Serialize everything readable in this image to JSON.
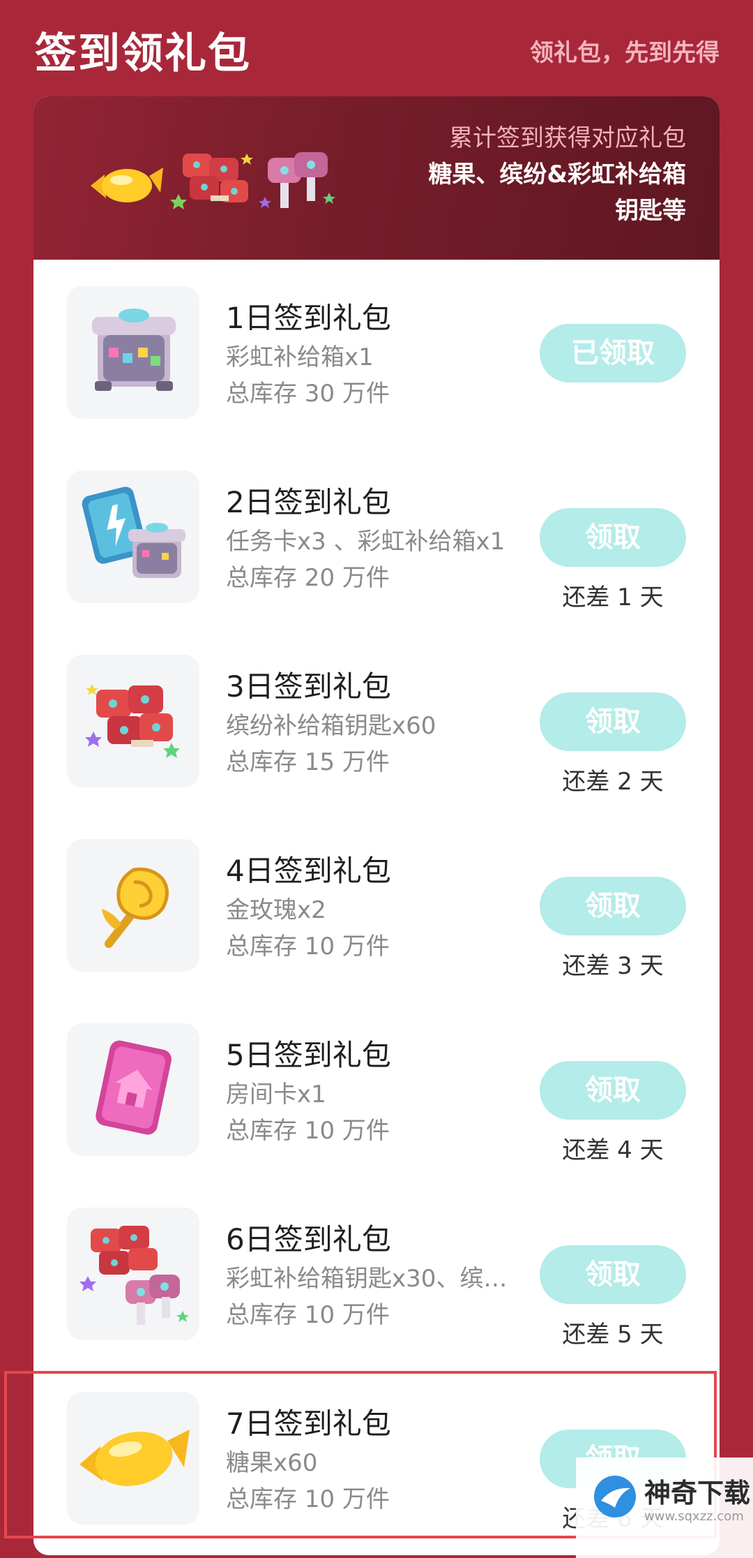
{
  "header": {
    "title": "签到领礼包",
    "subtitle": "领礼包，先到先得"
  },
  "banner": {
    "line1": "累计签到获得对应礼包",
    "line2": "糖果、缤纷&彩虹补给箱",
    "line3": "钥匙等",
    "icons": [
      "candy-icon",
      "confetti-keys-icon",
      "rainbow-keys-icon"
    ]
  },
  "rewards": [
    {
      "title": "1日签到礼包",
      "desc": "彩虹补给箱x1",
      "stock": "总库存 30 万件",
      "button": "已领取",
      "remaining": "",
      "icon": "rainbow-supply-box-icon"
    },
    {
      "title": "2日签到礼包",
      "desc": "任务卡x3 、彩虹补给箱x1",
      "stock": "总库存 20 万件",
      "button": "领取",
      "remaining": "还差 1 天",
      "icon": "task-card-and-box-icon"
    },
    {
      "title": "3日签到礼包",
      "desc": "缤纷补给箱钥匙x60",
      "stock": "总库存 15 万件",
      "button": "领取",
      "remaining": "还差 2 天",
      "icon": "confetti-keys-icon"
    },
    {
      "title": "4日签到礼包",
      "desc": "金玫瑰x2",
      "stock": "总库存 10 万件",
      "button": "领取",
      "remaining": "还差 3 天",
      "icon": "gold-rose-icon"
    },
    {
      "title": "5日签到礼包",
      "desc": "房间卡x1",
      "stock": "总库存 10 万件",
      "button": "领取",
      "remaining": "还差 4 天",
      "icon": "room-card-icon"
    },
    {
      "title": "6日签到礼包",
      "desc": "彩虹补给箱钥匙x30、缤…",
      "stock": "总库存 10 万件",
      "button": "领取",
      "remaining": "还差 5 天",
      "icon": "mixed-keys-icon"
    },
    {
      "title": "7日签到礼包",
      "desc": "糖果x60",
      "stock": "总库存 10 万件",
      "button": "领取",
      "remaining": "还差 6 天",
      "icon": "candy-icon"
    }
  ],
  "watermark": {
    "name": "神奇下载",
    "url": "www.sqxzz.com"
  },
  "colors": {
    "background": "#a8283a",
    "banner": "#7a1e2b",
    "button": "#b3ece8",
    "highlight": "#e5474f"
  }
}
